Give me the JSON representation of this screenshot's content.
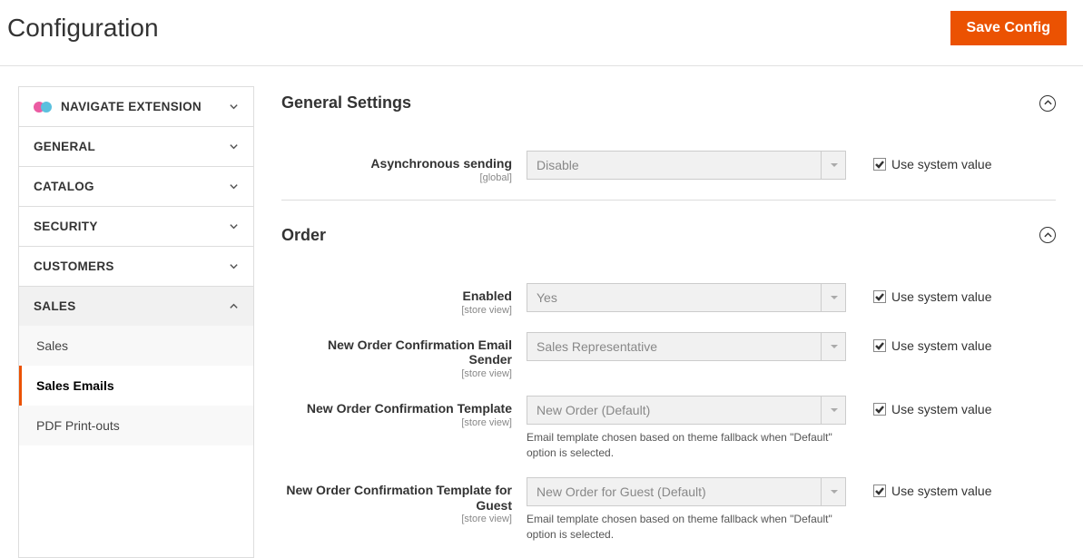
{
  "page_title": "Configuration",
  "save_button": "Save Config",
  "sidebar": {
    "sections": [
      {
        "label": "NAVIGATE EXTENSION",
        "has_icon": true,
        "expanded": false
      },
      {
        "label": "GENERAL",
        "expanded": false
      },
      {
        "label": "CATALOG",
        "expanded": false
      },
      {
        "label": "SECURITY",
        "expanded": false
      },
      {
        "label": "CUSTOMERS",
        "expanded": false
      },
      {
        "label": "SALES",
        "expanded": true
      }
    ],
    "sub_items": [
      {
        "label": "Sales",
        "active": false
      },
      {
        "label": "Sales Emails",
        "active": true
      },
      {
        "label": "PDF Print-outs",
        "active": false
      }
    ]
  },
  "sections": {
    "general": {
      "title": "General Settings",
      "fields": {
        "async_sending": {
          "label": "Asynchronous sending",
          "scope": "[global]",
          "value": "Disable",
          "use_system_label": "Use system value"
        }
      }
    },
    "order": {
      "title": "Order",
      "fields": {
        "enabled": {
          "label": "Enabled",
          "scope": "[store view]",
          "value": "Yes",
          "use_system_label": "Use system value"
        },
        "sender": {
          "label": "New Order Confirmation Email Sender",
          "scope": "[store view]",
          "value": "Sales Representative",
          "use_system_label": "Use system value"
        },
        "template": {
          "label": "New Order Confirmation Template",
          "scope": "[store view]",
          "value": "New Order (Default)",
          "hint": "Email template chosen based on theme fallback when \"Default\" option is selected.",
          "use_system_label": "Use system value"
        },
        "guest_template": {
          "label": "New Order Confirmation Template for Guest",
          "scope": "[store view]",
          "value": "New Order for Guest (Default)",
          "hint": "Email template chosen based on theme fallback when \"Default\" option is selected.",
          "use_system_label": "Use system value"
        }
      }
    }
  }
}
